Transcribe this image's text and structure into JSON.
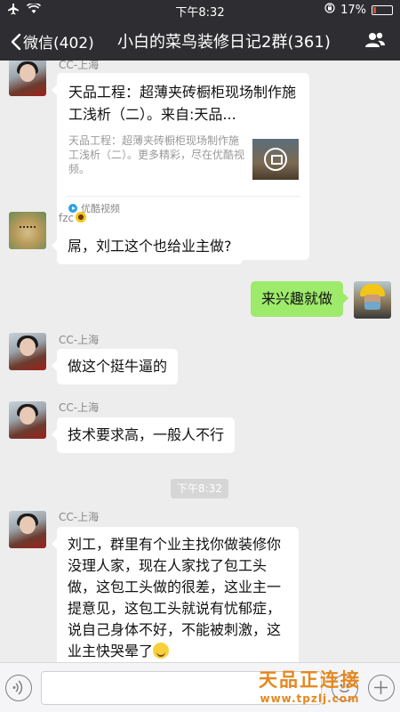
{
  "status_bar": {
    "time": "下午8:32",
    "battery": "17%",
    "battery_level": 0.17,
    "battery_color": "#e0473a",
    "icons": [
      "airplane-icon",
      "wifi-icon",
      "rotation-lock-icon",
      "battery-icon"
    ]
  },
  "nav": {
    "back_label": "微信(402)",
    "title": "小白的菜鸟装修日记2群(361)",
    "people_icon": "group-members-icon"
  },
  "messages": {
    "m1": {
      "sender": "CC-上海",
      "card": {
        "title": "天品工程：超薄夹砖橱柜现场制作施工浅析（二）。来自:天品...",
        "description": "天品工程：超薄夹砖橱柜现场制作施工浅析（二）。更多精彩，尽在优酷视频。",
        "source": "优酷视频"
      }
    },
    "m2": {
      "sender": "fzc",
      "text": "屌，刘工这个也给业主做?"
    },
    "m3": {
      "text": "来兴趣就做"
    },
    "m4": {
      "sender": "CC-上海",
      "text": "做这个挺牛逼的"
    },
    "m5": {
      "sender": "CC-上海",
      "text": "技术要求高，一般人不行"
    },
    "time_divider": "下午8:32",
    "m6": {
      "sender": "CC-上海",
      "text": "刘工，群里有个业主找你做装修你没理人家，现在人家找了包工头做，这包工头做的很差，这业主一提意见，这包工头就说有忧郁症，说自己身体不好，不能被刺激，这业主快哭晕了"
    }
  },
  "watermark": {
    "brand": "天品正连接",
    "url": "www.tpzlj.com"
  },
  "colors": {
    "header_bg": "#2e2e32",
    "chat_bg": "#ededed",
    "sent_bubble": "#9eea6a",
    "watermark": "#e6871e"
  }
}
